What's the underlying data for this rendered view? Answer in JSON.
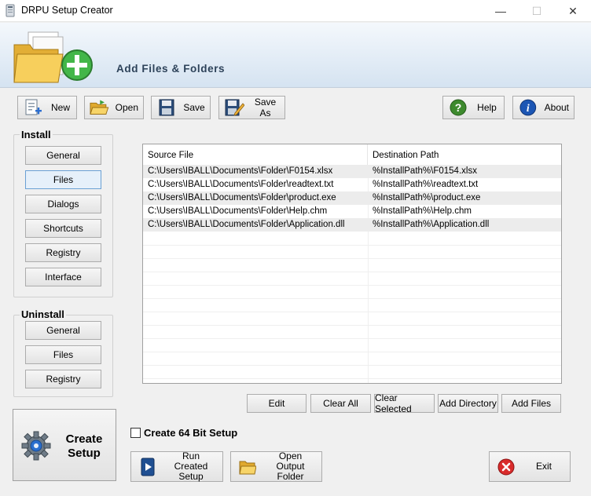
{
  "window": {
    "title": "DRPU Setup Creator",
    "minimize": "—",
    "maximize": "☐",
    "close": "✕"
  },
  "header": {
    "title": "Add Files & Folders"
  },
  "toolbar": {
    "new": "New",
    "open": "Open",
    "save": "Save",
    "save_as": "Save As",
    "help": "Help",
    "about": "About"
  },
  "install": {
    "label": "Install",
    "items": [
      "General",
      "Files",
      "Dialogs",
      "Shortcuts",
      "Registry",
      "Interface"
    ],
    "selected": "Files"
  },
  "uninstall": {
    "label": "Uninstall",
    "items": [
      "General",
      "Files",
      "Registry"
    ]
  },
  "table": {
    "columns": [
      "Source File",
      "Destination Path"
    ],
    "rows": [
      [
        "C:\\Users\\IBALL\\Documents\\Folder\\F0154.xlsx",
        "%InstallPath%\\F0154.xlsx"
      ],
      [
        "C:\\Users\\IBALL\\Documents\\Folder\\readtext.txt",
        "%InstallPath%\\readtext.txt"
      ],
      [
        "C:\\Users\\IBALL\\Documents\\Folder\\product.exe",
        "%InstallPath%\\product.exe"
      ],
      [
        "C:\\Users\\IBALL\\Documents\\Folder\\Help.chm",
        "%InstallPath%\\Help.chm"
      ],
      [
        "C:\\Users\\IBALL\\Documents\\Folder\\Application.dll",
        "%InstallPath%\\Application.dll"
      ]
    ]
  },
  "actions": {
    "edit": "Edit",
    "clear_all": "Clear All",
    "clear_selected": "Clear Selected",
    "add_directory": "Add Directory",
    "add_files": "Add Files"
  },
  "options": {
    "create_64bit": "Create 64 Bit Setup",
    "create_64bit_checked": false
  },
  "bottom": {
    "create_setup_line1": "Create",
    "create_setup_line2": "Setup",
    "run_line1": "Run Created",
    "run_line2": "Setup",
    "open_output_line1": "Open Output",
    "open_output_line2": "Folder",
    "exit": "Exit"
  },
  "colors": {
    "accent": "#2d4259",
    "help_green": "#3d8a2e",
    "about_blue": "#1c56b4",
    "exit_red": "#d92b2b",
    "folder_yellow": "#f0c64a"
  }
}
